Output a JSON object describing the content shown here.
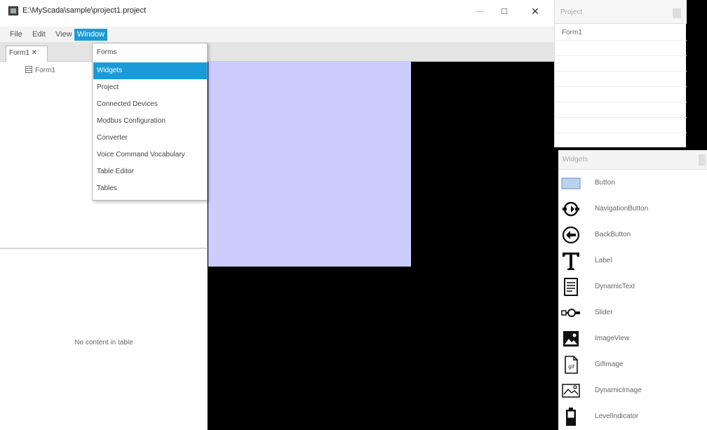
{
  "window": {
    "title": "E:\\MyScada\\sample\\project1.project",
    "controls": {
      "minimize": "—",
      "maximize": "□",
      "close": "✕"
    }
  },
  "menubar": {
    "items": [
      {
        "label": "File"
      },
      {
        "label": "Edit"
      },
      {
        "label": "View"
      },
      {
        "label": "Window"
      }
    ]
  },
  "tabs": {
    "form_tab": "Form1 ✕"
  },
  "tree": {
    "root_label": "Form1"
  },
  "table": {
    "empty_text": "No content in table"
  },
  "window_menu": {
    "items": [
      {
        "label": "Forms"
      },
      {
        "label": "Widgets"
      },
      {
        "label": "Project"
      },
      {
        "label": "Connected Devices"
      },
      {
        "label": "Modbus Configuration"
      },
      {
        "label": "Converter"
      },
      {
        "label": "Voice Command Vocabulary"
      },
      {
        "label": "Table Editor"
      },
      {
        "label": "Tables"
      }
    ],
    "highlighted": "Widgets"
  },
  "project_panel": {
    "title": "Project",
    "items": [
      {
        "label": "Form1"
      }
    ]
  },
  "widgets_panel": {
    "title": "Widgets",
    "items": [
      {
        "label": "Button",
        "icon": "button-icon"
      },
      {
        "label": "NavigationButton",
        "icon": "navigation-button-icon"
      },
      {
        "label": "BackButton",
        "icon": "back-button-icon"
      },
      {
        "label": "Label",
        "icon": "label-icon"
      },
      {
        "label": "DynamicText",
        "icon": "dynamic-text-icon"
      },
      {
        "label": "Slider",
        "icon": "slider-icon"
      },
      {
        "label": "ImageView",
        "icon": "image-view-icon"
      },
      {
        "label": "GifImage",
        "icon": "gif-image-icon"
      },
      {
        "label": "DynamicImage",
        "icon": "dynamic-image-icon"
      },
      {
        "label": "LevelIndicator",
        "icon": "level-indicator-icon"
      }
    ]
  },
  "colors": {
    "accent": "#1a9bd7",
    "form_background": "#ccccff",
    "canvas_background": "#000000"
  }
}
